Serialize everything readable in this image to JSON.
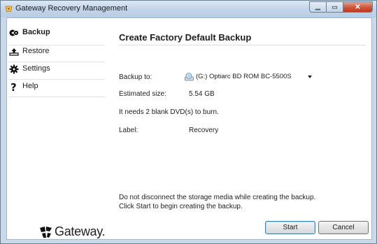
{
  "window": {
    "title": "Gateway Recovery Management",
    "controls": {
      "minimize": "minimize-icon",
      "maximize": "maximize-icon",
      "close": "close-icon"
    }
  },
  "sidebar": {
    "items": [
      {
        "label": "Backup",
        "icon": "backup-disc-icon",
        "active": true
      },
      {
        "label": "Restore",
        "icon": "restore-icon",
        "active": false
      },
      {
        "label": "Settings",
        "icon": "settings-icon",
        "active": false
      },
      {
        "label": "Help",
        "icon": "help-icon",
        "active": false
      }
    ],
    "brand": "Gateway."
  },
  "main": {
    "heading": "Create Factory Default Backup",
    "backup_to_label": "Backup to:",
    "backup_to_value": "(G:) Optiarc  BD ROM BC-5500S",
    "estimated_size_label": "Estimated size:",
    "estimated_size_value": "5.54 GB",
    "blank_dvd_note": "It needs 2 blank DVD(s) to burn.",
    "label_label": "Label:",
    "label_value": "Recovery",
    "warning_line1": "Do not disconnect the storage media while creating the backup.",
    "warning_line2": "Click Start to begin creating the backup.",
    "start_button": "Start",
    "cancel_button": "Cancel"
  },
  "colors": {
    "titlebar": "#c3d5ea",
    "close_button": "#c1371d",
    "default_button_border": "#3c7fb1"
  }
}
